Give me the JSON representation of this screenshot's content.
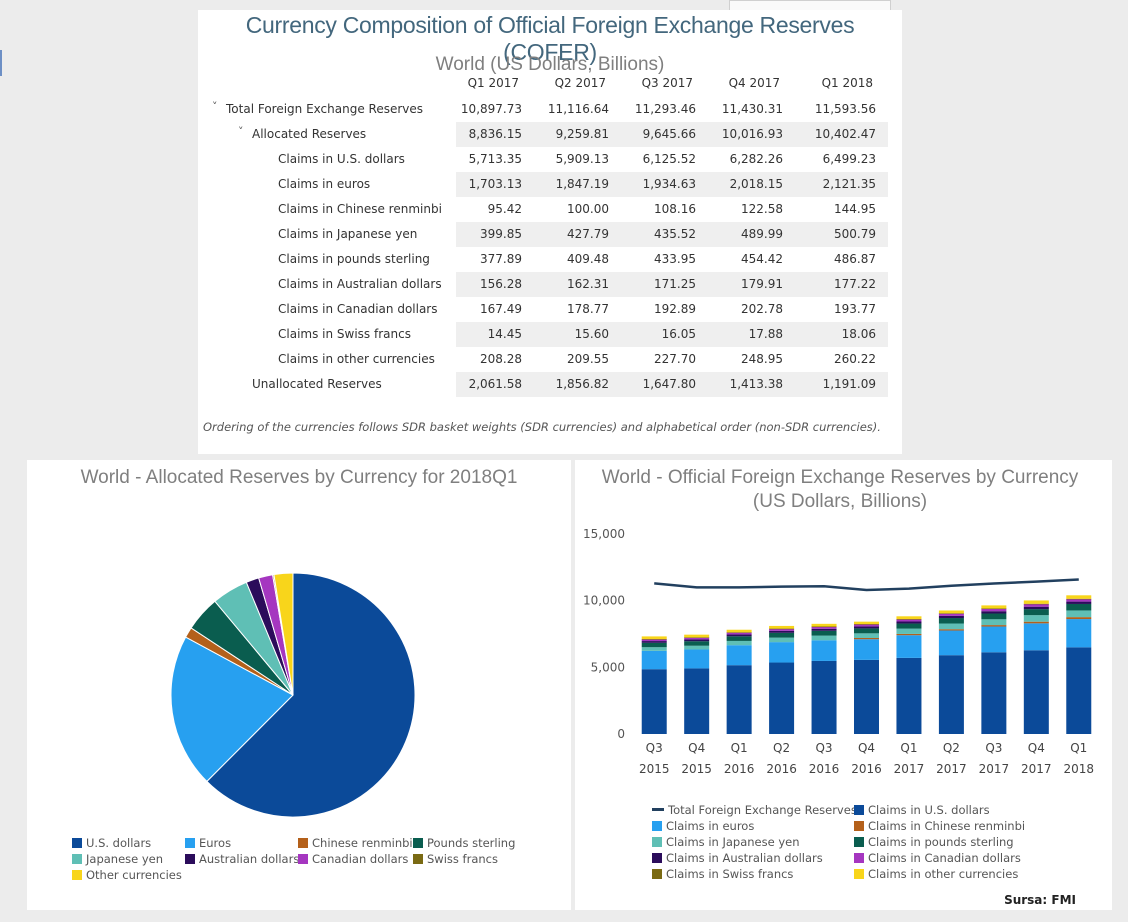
{
  "table": {
    "title": "Currency Composition of Official Foreign Exchange Reserves (COFER)",
    "subtitle": "World (US Dollars, Billions)",
    "columns": [
      "Q1 2017",
      "Q2 2017",
      "Q3 2017",
      "Q4 2017",
      "Q1 2018"
    ],
    "rows": [
      {
        "label": "Total Foreign Exchange Reserves",
        "level": 0,
        "expandable": true,
        "shaded": false,
        "values": [
          "10,897.73",
          "11,116.64",
          "11,293.46",
          "11,430.31",
          "11,593.56"
        ]
      },
      {
        "label": "Allocated Reserves",
        "level": 1,
        "expandable": true,
        "shaded": true,
        "values": [
          "8,836.15",
          "9,259.81",
          "9,645.66",
          "10,016.93",
          "10,402.47"
        ]
      },
      {
        "label": "Claims in U.S. dollars",
        "level": 2,
        "expandable": false,
        "shaded": false,
        "values": [
          "5,713.35",
          "5,909.13",
          "6,125.52",
          "6,282.26",
          "6,499.23"
        ]
      },
      {
        "label": "Claims in euros",
        "level": 2,
        "expandable": false,
        "shaded": true,
        "values": [
          "1,703.13",
          "1,847.19",
          "1,934.63",
          "2,018.15",
          "2,121.35"
        ]
      },
      {
        "label": "Claims in Chinese renminbi",
        "level": 2,
        "expandable": false,
        "shaded": false,
        "values": [
          "95.42",
          "100.00",
          "108.16",
          "122.58",
          "144.95"
        ]
      },
      {
        "label": "Claims in Japanese yen",
        "level": 2,
        "expandable": false,
        "shaded": true,
        "values": [
          "399.85",
          "427.79",
          "435.52",
          "489.99",
          "500.79"
        ]
      },
      {
        "label": "Claims in pounds sterling",
        "level": 2,
        "expandable": false,
        "shaded": false,
        "values": [
          "377.89",
          "409.48",
          "433.95",
          "454.42",
          "486.87"
        ]
      },
      {
        "label": "Claims in Australian dollars",
        "level": 2,
        "expandable": false,
        "shaded": true,
        "values": [
          "156.28",
          "162.31",
          "171.25",
          "179.91",
          "177.22"
        ]
      },
      {
        "label": "Claims in Canadian dollars",
        "level": 2,
        "expandable": false,
        "shaded": false,
        "values": [
          "167.49",
          "178.77",
          "192.89",
          "202.78",
          "193.77"
        ]
      },
      {
        "label": "Claims in Swiss francs",
        "level": 2,
        "expandable": false,
        "shaded": true,
        "values": [
          "14.45",
          "15.60",
          "16.05",
          "17.88",
          "18.06"
        ]
      },
      {
        "label": "Claims in other currencies",
        "level": 2,
        "expandable": false,
        "shaded": false,
        "values": [
          "208.28",
          "209.55",
          "227.70",
          "248.95",
          "260.22"
        ]
      },
      {
        "label": "Unallocated Reserves",
        "level": 1,
        "expandable": false,
        "shaded": true,
        "values": [
          "2,061.58",
          "1,856.82",
          "1,647.80",
          "1,413.38",
          "1,191.09"
        ]
      }
    ],
    "note": "Ordering of the currencies follows SDR basket weights (SDR currencies) and alphabetical order (non-SDR currencies)."
  },
  "source": "Sursa: FMI",
  "colors": {
    "usd": "#0b4a99",
    "eur": "#27a0f0",
    "cny": "#b4601a",
    "gbp": "#0a5d4f",
    "jpy": "#5fbfb5",
    "aud": "#2b0c5b",
    "cad": "#a536c0",
    "chf": "#7a6a13",
    "other": "#f8d51b",
    "total_line": "#22405f"
  },
  "chart_data": [
    {
      "type": "pie",
      "title": "World - Allocated Reserves by Currency for 2018Q1",
      "slices": [
        {
          "label": "U.S. dollars",
          "value": 6499.23,
          "color_key": "usd"
        },
        {
          "label": "Euros",
          "value": 2121.35,
          "color_key": "eur"
        },
        {
          "label": "Chinese renminbi",
          "value": 144.95,
          "color_key": "cny"
        },
        {
          "label": "Pounds sterling",
          "value": 486.87,
          "color_key": "gbp"
        },
        {
          "label": "Japanese yen",
          "value": 500.79,
          "color_key": "jpy"
        },
        {
          "label": "Australian dollars",
          "value": 177.22,
          "color_key": "aud"
        },
        {
          "label": "Canadian dollars",
          "value": 193.77,
          "color_key": "cad"
        },
        {
          "label": "Swiss francs",
          "value": 18.06,
          "color_key": "chf"
        },
        {
          "label": "Other currencies",
          "value": 260.22,
          "color_key": "other"
        }
      ],
      "legend_placement": "bottom"
    },
    {
      "type": "bar",
      "stacked": true,
      "title": "World - Official Foreign Exchange Reserves by Currency",
      "subtitle": "(US Dollars, Billions)",
      "categories": [
        [
          "Q3",
          "2015"
        ],
        [
          "Q4",
          "2015"
        ],
        [
          "Q1",
          "2016"
        ],
        [
          "Q2",
          "2016"
        ],
        [
          "Q3",
          "2016"
        ],
        [
          "Q4",
          "2016"
        ],
        [
          "Q1",
          "2017"
        ],
        [
          "Q2",
          "2017"
        ],
        [
          "Q3",
          "2017"
        ],
        [
          "Q4",
          "2017"
        ],
        [
          "Q1",
          "2018"
        ]
      ],
      "ylim": [
        0,
        15000
      ],
      "yticks": [
        "0",
        "5,000",
        "10,000",
        "15,000"
      ],
      "ytick_values": [
        0,
        5000,
        10000,
        15000
      ],
      "line_series": {
        "name": "Total Foreign Exchange Reserves",
        "color_key": "total_line",
        "values": [
          11300,
          11000,
          11000,
          11050,
          11080,
          10800,
          10900,
          11120,
          11290,
          11430,
          11590
        ]
      },
      "series": [
        {
          "name": "Claims in U.S. dollars",
          "color_key": "usd",
          "values": [
            4860,
            4920,
            5160,
            5360,
            5480,
            5560,
            5710,
            5910,
            6130,
            6280,
            6500
          ]
        },
        {
          "name": "Claims in euros",
          "color_key": "eur",
          "values": [
            1380,
            1420,
            1500,
            1530,
            1550,
            1550,
            1700,
            1850,
            1930,
            2020,
            2120
          ]
        },
        {
          "name": "Claims in Chinese renminbi",
          "color_key": "cny",
          "values": [
            0,
            0,
            0,
            0,
            0,
            90,
            95,
            100,
            108,
            123,
            145
          ]
        },
        {
          "name": "Claims in Japanese yen",
          "color_key": "jpy",
          "values": [
            270,
            280,
            320,
            340,
            350,
            350,
            400,
            428,
            436,
            490,
            501
          ]
        },
        {
          "name": "Claims in pounds sterling",
          "color_key": "gbp",
          "values": [
            330,
            340,
            350,
            360,
            360,
            370,
            378,
            409,
            434,
            454,
            487
          ]
        },
        {
          "name": "Claims in Australian dollars",
          "color_key": "aud",
          "values": [
            130,
            135,
            140,
            145,
            150,
            150,
            156,
            162,
            171,
            180,
            177
          ]
        },
        {
          "name": "Claims in Canadian dollars",
          "color_key": "cad",
          "values": [
            130,
            135,
            140,
            150,
            155,
            160,
            167,
            179,
            193,
            203,
            194
          ]
        },
        {
          "name": "Claims in Swiss francs",
          "color_key": "chf",
          "values": [
            20,
            20,
            20,
            20,
            18,
            15,
            14,
            16,
            16,
            18,
            18
          ]
        },
        {
          "name": "Claims in other currencies",
          "color_key": "other",
          "values": [
            200,
            200,
            190,
            200,
            200,
            180,
            208,
            210,
            228,
            249,
            260
          ]
        }
      ],
      "legend": [
        {
          "label": "Total Foreign Exchange Reserves",
          "color_key": "total_line",
          "kind": "line"
        },
        {
          "label": "Claims in U.S. dollars",
          "color_key": "usd",
          "kind": "box"
        },
        {
          "label": "Claims in euros",
          "color_key": "eur",
          "kind": "box"
        },
        {
          "label": "Claims in Chinese renminbi",
          "color_key": "cny",
          "kind": "box"
        },
        {
          "label": "Claims in Japanese yen",
          "color_key": "jpy",
          "kind": "box"
        },
        {
          "label": "Claims in pounds sterling",
          "color_key": "gbp",
          "kind": "box"
        },
        {
          "label": "Claims in Australian dollars",
          "color_key": "aud",
          "kind": "box"
        },
        {
          "label": "Claims in Canadian dollars",
          "color_key": "cad",
          "kind": "box"
        },
        {
          "label": "Claims in Swiss francs",
          "color_key": "chf",
          "kind": "box"
        },
        {
          "label": "Claims in other currencies",
          "color_key": "other",
          "kind": "box"
        }
      ],
      "legend_placement": "bottom",
      "grid": false
    }
  ]
}
